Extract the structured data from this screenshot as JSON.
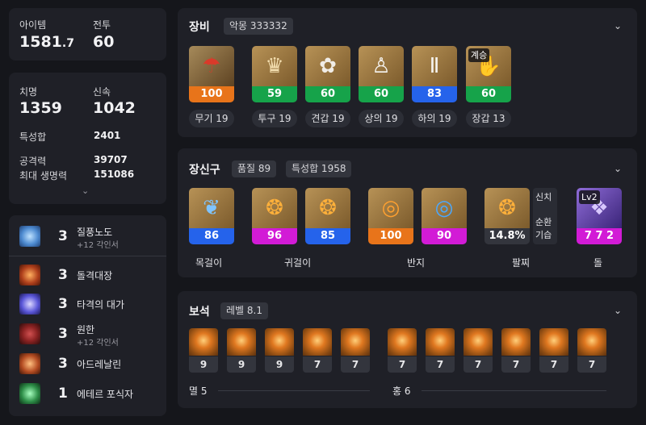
{
  "summary": {
    "item_label": "아이템",
    "item_main": "1581",
    "item_dec": ".7",
    "combat_label": "전투",
    "combat_value": "60"
  },
  "stats": {
    "crit_label": "치명",
    "crit_value": "1359",
    "swift_label": "신속",
    "swift_value": "1042",
    "total_label": "특성합",
    "total_value": "2401",
    "atk_label": "공격력",
    "atk_value": "39707",
    "hp_label": "최대 생명력",
    "hp_value": "151086",
    "expand_icon": "chevron-down-icon"
  },
  "engravings": [
    {
      "level": "3",
      "name": "질풍노도",
      "sub": "+12 각인서",
      "color": "#4e8bd1"
    },
    {
      "level": "3",
      "name": "돌격대장",
      "sub": "",
      "color": "#b0401c"
    },
    {
      "level": "3",
      "name": "타격의 대가",
      "sub": "",
      "color": "#5a56d8"
    },
    {
      "level": "3",
      "name": "원한",
      "sub": "+12 각인서",
      "color": "#8a2222"
    },
    {
      "level": "3",
      "name": "아드레날린",
      "sub": "",
      "color": "#b44c22"
    },
    {
      "level": "1",
      "name": "에테르 포식자",
      "sub": "",
      "color": "#2e8e48"
    }
  ],
  "equipment": {
    "title": "장비",
    "set_tag": "악몽 333332",
    "items": [
      {
        "quality": "100",
        "color": "#e8741a",
        "label": "무기 19",
        "icon": "parasol-weapon-icon",
        "glyph": "☂",
        "badge": ""
      },
      {
        "quality": "59",
        "color": "#16a34a",
        "label": "투구 19",
        "icon": "helmet-icon",
        "glyph": "♛",
        "badge": ""
      },
      {
        "quality": "60",
        "color": "#16a34a",
        "label": "견갑 19",
        "icon": "shoulder-icon",
        "glyph": "✿",
        "badge": ""
      },
      {
        "quality": "60",
        "color": "#16a34a",
        "label": "상의 19",
        "icon": "dress-icon",
        "glyph": "♙",
        "badge": ""
      },
      {
        "quality": "83",
        "color": "#2563eb",
        "label": "하의 19",
        "icon": "pants-icon",
        "glyph": "Ⅱ",
        "badge": ""
      },
      {
        "quality": "60",
        "color": "#16a34a",
        "label": "장갑 13",
        "icon": "glove-icon",
        "glyph": "✋",
        "badge": "계승"
      }
    ]
  },
  "accessories": {
    "title": "장신구",
    "quality_tag": "품질 89",
    "total_tag": "특성합 1958",
    "items": [
      {
        "quality": "86",
        "color": "#2563eb",
        "icon": "necklace-icon",
        "glyph": "❦"
      },
      {
        "quality": "96",
        "color": "#d21bd6",
        "icon": "earring-icon",
        "glyph": "❂"
      },
      {
        "quality": "85",
        "color": "#2563eb",
        "icon": "earring-icon",
        "glyph": "❂"
      },
      {
        "quality": "100",
        "color": "#e8741a",
        "icon": "ring-icon",
        "glyph": "◎"
      },
      {
        "quality": "90",
        "color": "#d21bd6",
        "icon": "ring-icon",
        "glyph": "◎"
      },
      {
        "quality": "14.8%",
        "color": "#33353d",
        "icon": "bracelet-icon",
        "glyph": "❂"
      },
      {
        "quality": "7 7 2",
        "color": "#d21bd6",
        "icon": "stone-icon",
        "glyph": "❖"
      }
    ],
    "bracelet_effects": [
      "신치",
      "순환",
      "기습"
    ],
    "stone_level": "Lv2",
    "labels": {
      "necklace": "목걸이",
      "earring": "귀걸이",
      "ring": "반지",
      "bracelet": "팔찌",
      "stone": "돌"
    }
  },
  "gems": {
    "title": "보석",
    "level_tag": "레벨 8.1",
    "group1": [
      "9",
      "9",
      "9",
      "7",
      "7"
    ],
    "group2": [
      "7",
      "7",
      "7",
      "7",
      "7",
      "7"
    ],
    "group1_label": "멸 5",
    "group2_label": "홍 6"
  }
}
